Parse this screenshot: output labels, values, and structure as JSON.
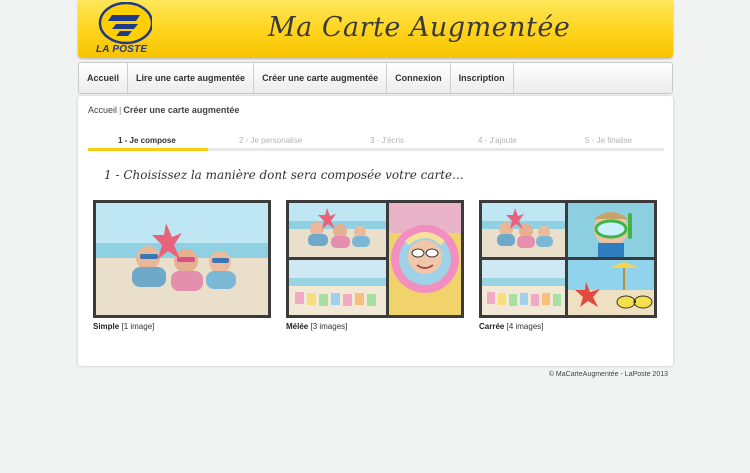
{
  "header": {
    "logo_text": "LA POSTE",
    "title": "Ma Carte Augmentée"
  },
  "nav": {
    "items": [
      "Accueil",
      "Lire une carte augmentée",
      "Créer une carte augmentée",
      "Connexion",
      "Inscription"
    ]
  },
  "breadcrumb": {
    "home": "Accueil",
    "separator": "|",
    "current": "Créer une carte augmentée"
  },
  "steps": [
    "1 - Je compose",
    "2 - Je personalise",
    "3 - J'écris",
    "4 - J'ajoute",
    "5 - Je finalise"
  ],
  "active_step": 1,
  "instruction": "1 - Choisissez la manière dont sera composée votre carte...",
  "options": [
    {
      "name": "Simple",
      "count": "[1 image]"
    },
    {
      "name": "Mélée",
      "count": "[3 images]"
    },
    {
      "name": "Carrée",
      "count": "[4 images]"
    }
  ],
  "footer": {
    "text": "© MaCarteAugmentée - LaPoste 2013"
  },
  "colors": {
    "brand_yellow": "#ffd31c",
    "logo_blue": "#1e3a8a",
    "active_step": "#f6cd10",
    "frame": "#3b3b3b"
  },
  "photos": [
    "kids-beach-photo",
    "kid-inflatable-photo",
    "beach-chairs-photo",
    "kid-snorkel-photo",
    "sunglasses-starfish-photo"
  ]
}
